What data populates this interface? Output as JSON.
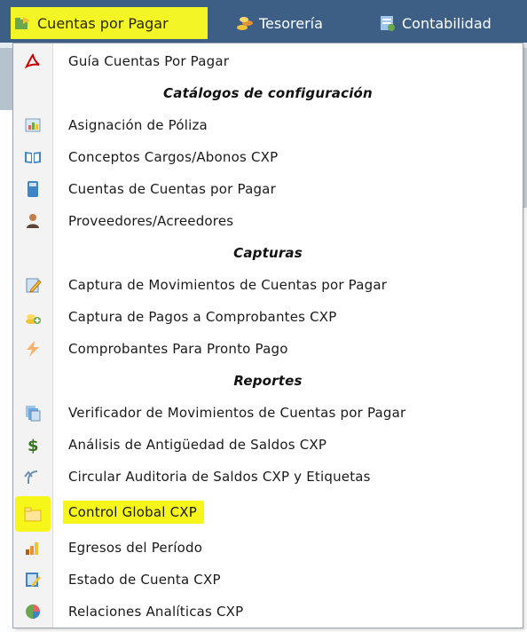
{
  "menubar": {
    "items": [
      {
        "label": "Cuentas por Pagar",
        "icon": "folder-arrow-icon"
      },
      {
        "label": "Tesorería",
        "icon": "coins-icon"
      },
      {
        "label": "Contabilidad",
        "icon": "ledger-icon"
      }
    ]
  },
  "dropdown": {
    "items": [
      {
        "label": "Guía Cuentas Por Pagar",
        "icon": "pdf-icon"
      },
      {
        "label": "Catálogos de configuración",
        "type": "header"
      },
      {
        "label": "Asignación de Póliza",
        "icon": "chart-sheet-icon"
      },
      {
        "label": "Conceptos Cargos/Abonos CXP",
        "icon": "book-icon"
      },
      {
        "label": "Cuentas de Cuentas por Pagar",
        "icon": "calculator-icon"
      },
      {
        "label": "Proveedores/Acreedores",
        "icon": "person-icon"
      },
      {
        "label": "Capturas",
        "type": "header"
      },
      {
        "label": "Captura de Movimientos de Cuentas por Pagar",
        "icon": "edit-document-icon"
      },
      {
        "label": "Captura de Pagos a Comprobantes CXP",
        "icon": "coins-plus-icon"
      },
      {
        "label": "Comprobantes Para Pronto Pago",
        "icon": "lightning-icon"
      },
      {
        "label": "Reportes",
        "type": "header"
      },
      {
        "label": "Verificador de Movimientos de Cuentas por Pagar",
        "icon": "stacked-documents-icon"
      },
      {
        "label": "Análisis de Antigüedad de Saldos CXP",
        "icon": "dollar-icon"
      },
      {
        "label": "Circular Auditoria de Saldos CXP y Etiquetas",
        "icon": "undo-arrow-icon"
      },
      {
        "label": "Control Global CXP",
        "icon": "folder-icon",
        "highlighted": true
      },
      {
        "label": "Egresos del Período",
        "icon": "bar-coins-icon"
      },
      {
        "label": "Estado de Cuenta CXP",
        "icon": "edit-sheet-icon"
      },
      {
        "label": "Relaciones Analíticas CXP",
        "icon": "pie-chart-icon"
      }
    ]
  },
  "colors": {
    "menubar": "#3d5f86",
    "highlight": "#f6f61b"
  }
}
